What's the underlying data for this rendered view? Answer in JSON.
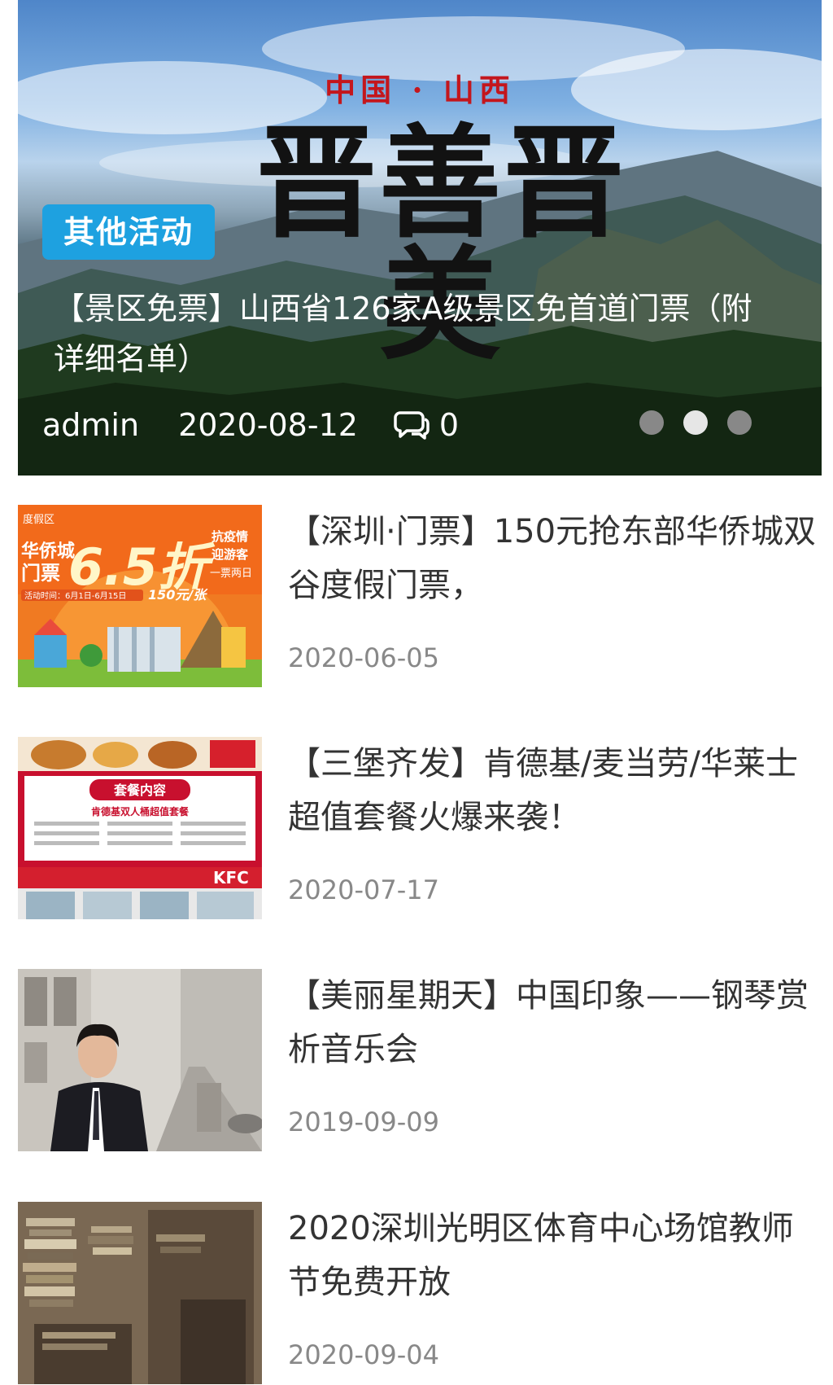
{
  "hero": {
    "banner_kicker": "中国 · 山西",
    "banner_title": "晋善晋美",
    "category": "其他活动",
    "title": "【景区免票】山西省126家A级景区免首道门票（附详细名单）",
    "author": "admin",
    "date": "2020-08-12",
    "comments": "0",
    "comment_icon": "comment-bubble-icon",
    "slides_total": 3,
    "active_slide": 2
  },
  "posts": [
    {
      "title": "【深圳·门票】150元抢东部华侨城双谷度假门票，",
      "date": "2020-06-05",
      "thumb": {
        "kind": "promo",
        "top_left": "度假区",
        "left_lines": [
          "华侨城",
          "门票"
        ],
        "discount": "6.5折",
        "right_lines": [
          "抗疫情",
          "迎游客",
          "一票两日"
        ],
        "price": "150元/张",
        "strip": "活动时间：6月1日-6月15日"
      }
    },
    {
      "title": "【三堡齐发】肯德基/麦当劳/华莱士 超值套餐火爆来袭！",
      "date": "2020-07-17",
      "thumb": {
        "kind": "kfc",
        "header": "套餐内容",
        "subheader": "肯德基双人桶超值套餐",
        "store": "KFC"
      }
    },
    {
      "title": "【美丽星期天】中国印象——钢琴赏析音乐会",
      "date": "2019-09-09",
      "thumb": {
        "kind": "portrait"
      }
    },
    {
      "title": "2020深圳光明区体育中心场馆教师节免费开放",
      "date": "2020-09-04",
      "thumb": {
        "kind": "books"
      }
    }
  ],
  "colors": {
    "tag_bg": "#1ea1e0",
    "kicker_red": "#c4161c",
    "title_text": "#333333",
    "date_text": "#888888"
  }
}
